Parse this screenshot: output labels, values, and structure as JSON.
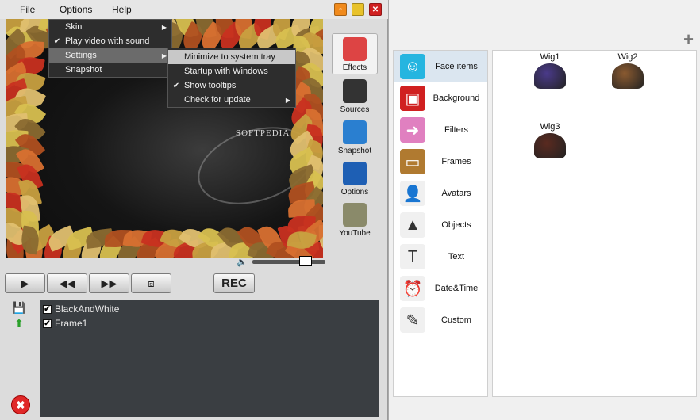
{
  "menubar": {
    "file": "File",
    "options": "Options",
    "help": "Help"
  },
  "window_buttons": {
    "restore": "▫",
    "minimize": "–",
    "close": "✕"
  },
  "menu": {
    "items": [
      {
        "label": "Skin",
        "checked": false,
        "submenu": true
      },
      {
        "label": "Play video with sound",
        "checked": true,
        "submenu": false
      },
      {
        "label": "Settings",
        "checked": false,
        "submenu": true
      },
      {
        "label": "Snapshot",
        "checked": false,
        "submenu": false
      }
    ],
    "settings_submenu": [
      {
        "label": "Minimize to system tray",
        "checked": false
      },
      {
        "label": "Startup with Windows",
        "checked": false
      },
      {
        "label": "Show tooltips",
        "checked": true
      },
      {
        "label": "Check for update",
        "checked": false,
        "submenu": true
      }
    ],
    "check_mark": "✔",
    "arrow": "▶"
  },
  "video": {
    "watermark": "SOFTPEDIA"
  },
  "side_buttons": [
    {
      "label": "Effects",
      "icon": "effects-icon",
      "color": "#d44"
    },
    {
      "label": "Sources",
      "icon": "camera-icon",
      "color": "#333"
    },
    {
      "label": "Snapshot",
      "icon": "snapshot-icon",
      "color": "#2a7fd0"
    },
    {
      "label": "Options",
      "icon": "options-icon",
      "color": "#1e5fb4"
    },
    {
      "label": "YouTube",
      "icon": "youtube-icon",
      "color": "#8a8a6a"
    }
  ],
  "volume": {
    "icon": "🔈",
    "level": 0.73
  },
  "controls": {
    "play": "▶",
    "rewind": "◀◀",
    "forward": "▶▶",
    "capture": "⧈",
    "rec": "REC"
  },
  "tools": {
    "save": "💾",
    "upload": "⬆",
    "delete": "✖"
  },
  "effects": [
    {
      "label": "BlackAndWhite",
      "checked": true
    },
    {
      "label": "Frame1",
      "checked": true
    }
  ],
  "right": {
    "add": "+",
    "categories": [
      {
        "label": "Face items",
        "icon": "face-items-icon",
        "glyph": "☺",
        "color": "#25b5e0"
      },
      {
        "label": "Background",
        "icon": "background-icon",
        "glyph": "▣",
        "color": "#d02020"
      },
      {
        "label": "Filters",
        "icon": "filters-icon",
        "glyph": "➜",
        "color": "#e080c0"
      },
      {
        "label": "Frames",
        "icon": "frames-icon",
        "glyph": "▭",
        "color": "#b07a30"
      },
      {
        "label": "Avatars",
        "icon": "avatar-icon",
        "glyph": "👤",
        "color": "#f0f0f0"
      },
      {
        "label": "Objects",
        "icon": "objects-icon",
        "glyph": "▲",
        "color": "#f0f0f0"
      },
      {
        "label": "Text",
        "icon": "text-icon",
        "glyph": "T",
        "color": "#f0f0f0"
      },
      {
        "label": "Date&Time",
        "icon": "clock-icon",
        "glyph": "⏰",
        "color": "#f0f0f0"
      },
      {
        "label": "Custom",
        "icon": "custom-icon",
        "glyph": "✎",
        "color": "#f0f0f0"
      }
    ],
    "items": [
      {
        "label": "Wig1",
        "color": "#4a3a8a"
      },
      {
        "label": "Wig2",
        "color": "#8a5a30"
      },
      {
        "label": "Wig3",
        "color": "#5a2a20"
      }
    ]
  }
}
